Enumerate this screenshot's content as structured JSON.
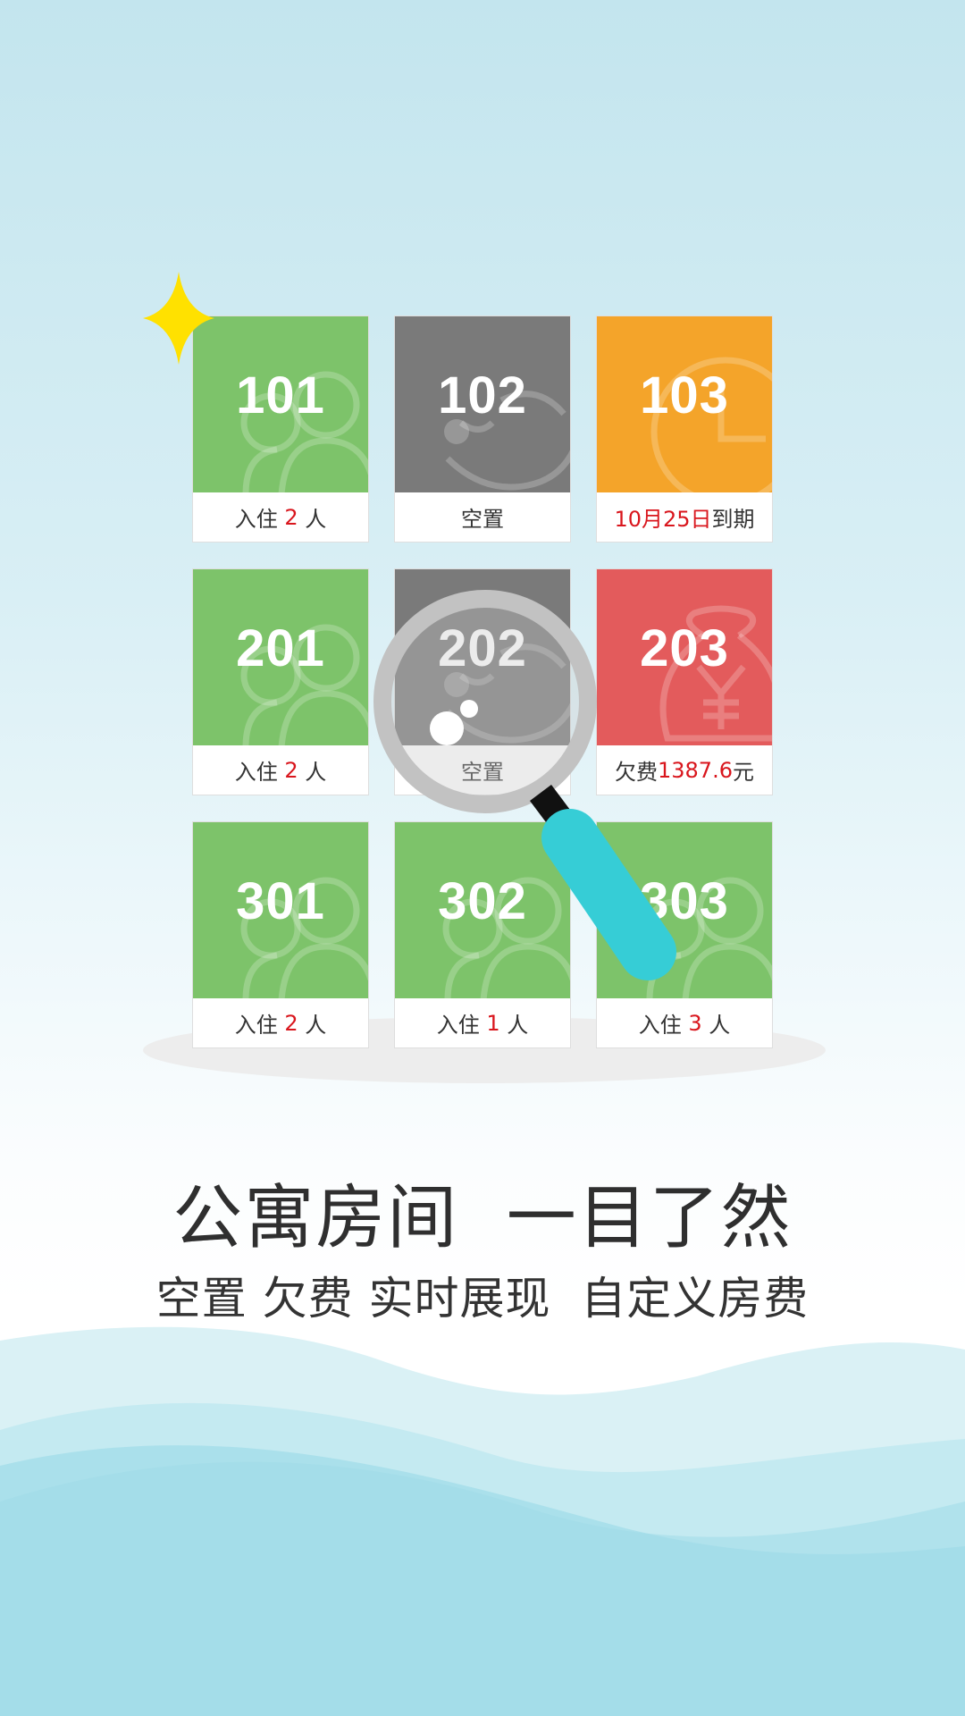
{
  "rooms": [
    {
      "number": "101",
      "status": "occupied",
      "color": "#7dc36a",
      "label_prefix": "入住 ",
      "label_value": "2",
      "label_suffix": " 人"
    },
    {
      "number": "102",
      "status": "vacant",
      "color": "#7a7a7a",
      "label_prefix": "",
      "label_value": "",
      "label_suffix": "空置"
    },
    {
      "number": "103",
      "status": "expiring",
      "color": "#f4a42a",
      "label_prefix": "",
      "label_value": "10月25日",
      "label_suffix": "到期"
    },
    {
      "number": "201",
      "status": "occupied",
      "color": "#7dc36a",
      "label_prefix": "入住 ",
      "label_value": "2",
      "label_suffix": " 人"
    },
    {
      "number": "202",
      "status": "vacant",
      "color": "#7a7a7a",
      "label_prefix": "",
      "label_value": "",
      "label_suffix": "空置"
    },
    {
      "number": "203",
      "status": "arrears",
      "color": "#e35b5c",
      "label_prefix": "欠费",
      "label_value": "1387.6",
      "label_suffix": "元"
    },
    {
      "number": "301",
      "status": "occupied",
      "color": "#7dc36a",
      "label_prefix": "入住 ",
      "label_value": "2",
      "label_suffix": " 人"
    },
    {
      "number": "302",
      "status": "occupied",
      "color": "#7dc36a",
      "label_prefix": "入住 ",
      "label_value": "1",
      "label_suffix": " 人"
    },
    {
      "number": "303",
      "status": "occupied",
      "color": "#7dc36a",
      "label_prefix": "入住 ",
      "label_value": "3",
      "label_suffix": " 人"
    }
  ],
  "icons": {
    "occupied": "people-icon",
    "vacant": "sleeping-face-icon",
    "expiring": "clock-icon",
    "arrears": "money-bag-icon",
    "sparkle": "sparkle-icon",
    "magnifier": "magnifying-glass-icon"
  },
  "colors": {
    "highlight": "#d9161d",
    "magnifier_handle": "#36cdd6",
    "sparkle": "#ffe100"
  },
  "headline": "公寓房间  一目了然",
  "subline": "空置 欠费 实时展现  自定义房费"
}
